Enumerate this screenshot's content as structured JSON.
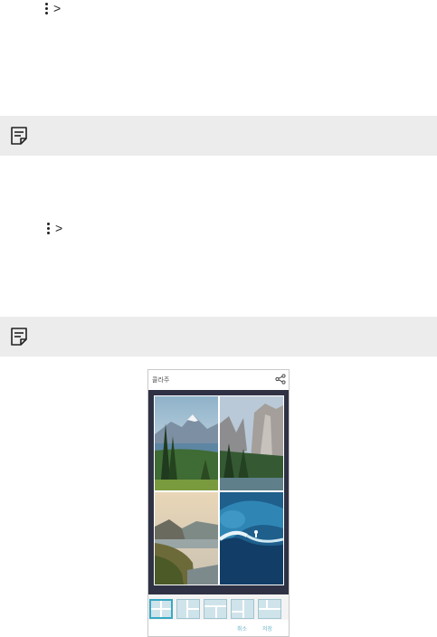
{
  "menu_path_1": {
    "icon": "more-vertical-icon",
    "separator": ">"
  },
  "menu_path_2": {
    "icon": "more-vertical-icon",
    "separator": ">"
  },
  "note_1": {
    "icon": "note-icon",
    "bg_color": "#ececec"
  },
  "note_2": {
    "icon": "note-icon",
    "bg_color": "#ececec"
  },
  "phone": {
    "title": "콜라주",
    "share_icon": "share-icon",
    "photos": [
      {
        "name": "mountain-lake-photo"
      },
      {
        "name": "cliff-valley-photo"
      },
      {
        "name": "coast-sunset-photo"
      },
      {
        "name": "ocean-wave-surfer-photo"
      }
    ],
    "layout_options": [
      "layout-2x2",
      "layout-3",
      "layout-4",
      "layout-5",
      "layout-6"
    ],
    "actions": {
      "cancel": "취소",
      "save": "저장"
    },
    "accent_color": "#38a9c4"
  }
}
